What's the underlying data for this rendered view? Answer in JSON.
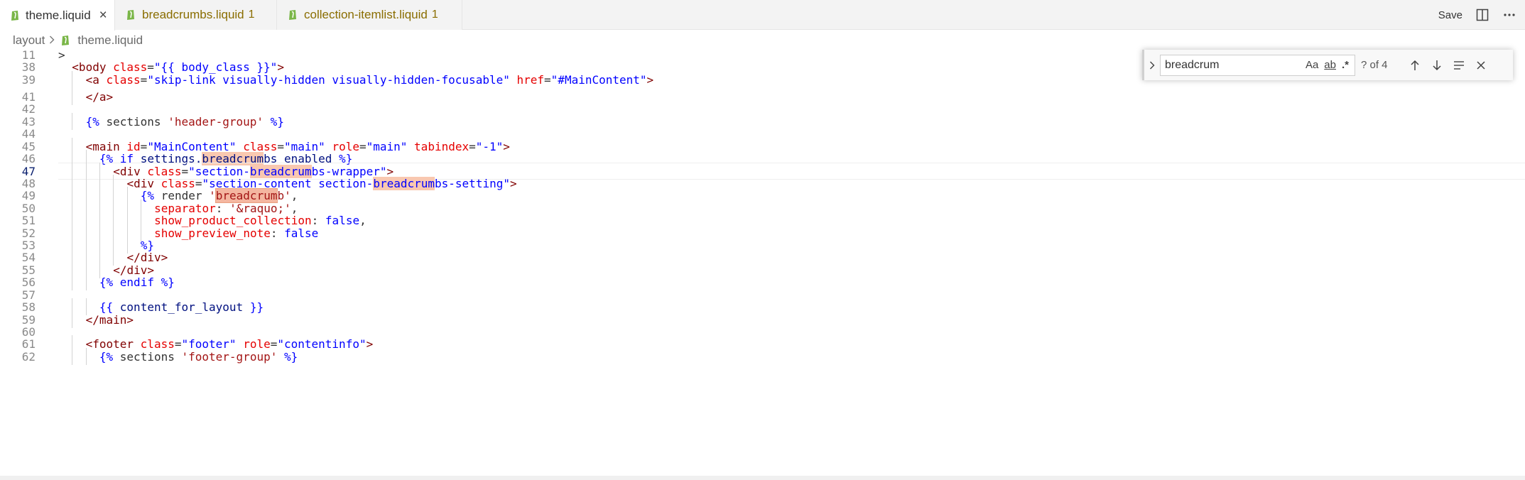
{
  "tabs": [
    {
      "label": "theme.liquid",
      "active": true,
      "badge": "",
      "close": "×"
    },
    {
      "label": "breadcrumbs.liquid",
      "active": false,
      "badge": "1",
      "close": ""
    },
    {
      "label": "collection-itemlist.liquid",
      "active": false,
      "badge": "1",
      "close": ""
    }
  ],
  "actions": {
    "save_label": "Save"
  },
  "breadcrumb": {
    "folder": "layout",
    "file": "theme.liquid"
  },
  "find": {
    "value": "breadcrum",
    "match_case": "Aa",
    "whole_word": "ab",
    "regex": ".*",
    "count": "? of 4"
  },
  "colors": {
    "liquid_icon": "#7ab648",
    "highlight": "#f9c8b0",
    "tag": "#800000",
    "attr": "#e50000",
    "string": "#0000ff"
  },
  "lines": [
    {
      "n": "11",
      "indent": 0,
      "segs": [
        {
          "c": "t-plain",
          "t": ">"
        }
      ]
    },
    {
      "n": "38",
      "indent": 1,
      "segs": [
        {
          "c": "t-tag",
          "t": "<body"
        },
        {
          "c": "t-plain",
          "t": " "
        },
        {
          "c": "t-attr",
          "t": "class"
        },
        {
          "c": "t-plain",
          "t": "="
        },
        {
          "c": "t-str",
          "t": "\"{{ body_class }}\""
        },
        {
          "c": "t-tag",
          "t": ">"
        }
      ]
    },
    {
      "n": "39",
      "indent": 2,
      "segs": [
        {
          "c": "t-tag",
          "t": "<a"
        },
        {
          "c": "t-plain",
          "t": " "
        },
        {
          "c": "t-attr",
          "t": "class"
        },
        {
          "c": "t-plain",
          "t": "="
        },
        {
          "c": "t-str",
          "t": "\"skip-link visually-hidden visually-hidden-focusable\""
        },
        {
          "c": "t-plain",
          "t": " "
        },
        {
          "c": "t-attr",
          "t": "href"
        },
        {
          "c": "t-plain",
          "t": "="
        },
        {
          "c": "t-str",
          "t": "\"#MainContent\""
        },
        {
          "c": "t-tag",
          "t": ">"
        }
      ]
    },
    {
      "n": "41",
      "indent": 2,
      "segs": [
        {
          "c": "t-tag",
          "t": "</a>"
        }
      ]
    },
    {
      "n": "42",
      "indent": 0,
      "segs": []
    },
    {
      "n": "43",
      "indent": 2,
      "segs": [
        {
          "c": "t-liq",
          "t": "{%"
        },
        {
          "c": "t-plain",
          "t": " sections "
        },
        {
          "c": "t-strl",
          "t": "'header-group'"
        },
        {
          "c": "t-liq",
          "t": " %}"
        }
      ]
    },
    {
      "n": "44",
      "indent": 0,
      "segs": []
    },
    {
      "n": "45",
      "indent": 2,
      "segs": [
        {
          "c": "t-tag",
          "t": "<main"
        },
        {
          "c": "t-plain",
          "t": " "
        },
        {
          "c": "t-attr",
          "t": "id"
        },
        {
          "c": "t-plain",
          "t": "="
        },
        {
          "c": "t-str",
          "t": "\"MainContent\""
        },
        {
          "c": "t-plain",
          "t": " "
        },
        {
          "c": "t-attr",
          "t": "class"
        },
        {
          "c": "t-plain",
          "t": "="
        },
        {
          "c": "t-str",
          "t": "\"main\""
        },
        {
          "c": "t-plain",
          "t": " "
        },
        {
          "c": "t-attr",
          "t": "role"
        },
        {
          "c": "t-plain",
          "t": "="
        },
        {
          "c": "t-str",
          "t": "\"main\""
        },
        {
          "c": "t-plain",
          "t": " "
        },
        {
          "c": "t-attr",
          "t": "tabindex"
        },
        {
          "c": "t-plain",
          "t": "="
        },
        {
          "c": "t-str",
          "t": "\"-1\""
        },
        {
          "c": "t-tag",
          "t": ">"
        }
      ]
    },
    {
      "n": "46",
      "indent": 3,
      "segs": [
        {
          "c": "t-liq",
          "t": "{%"
        },
        {
          "c": "t-kw",
          "t": " if "
        },
        {
          "c": "t-var",
          "t": "settings."
        },
        {
          "c": "t-var hl",
          "t": "breadcrum"
        },
        {
          "c": "t-var",
          "t": "bs_enabled"
        },
        {
          "c": "t-liq",
          "t": " %}"
        }
      ]
    },
    {
      "n": "47",
      "indent": 4,
      "cur": true,
      "segs": [
        {
          "c": "t-tag",
          "t": "<div"
        },
        {
          "c": "t-plain",
          "t": " "
        },
        {
          "c": "t-attr",
          "t": "class"
        },
        {
          "c": "t-plain",
          "t": "="
        },
        {
          "c": "t-str",
          "t": "\"section-"
        },
        {
          "c": "t-str hl",
          "t": "breadcrum"
        },
        {
          "c": "t-str",
          "t": "bs-wrapper\""
        },
        {
          "c": "t-tag",
          "t": ">"
        }
      ]
    },
    {
      "n": "48",
      "indent": 5,
      "segs": [
        {
          "c": "t-tag",
          "t": "<div"
        },
        {
          "c": "t-plain",
          "t": " "
        },
        {
          "c": "t-attr",
          "t": "class"
        },
        {
          "c": "t-plain",
          "t": "="
        },
        {
          "c": "t-str",
          "t": "\"section-content section-"
        },
        {
          "c": "t-str hl",
          "t": "breadcrum"
        },
        {
          "c": "t-str",
          "t": "bs-setting\""
        },
        {
          "c": "t-tag",
          "t": ">"
        }
      ]
    },
    {
      "n": "49",
      "indent": 6,
      "segs": [
        {
          "c": "t-liq",
          "t": "{%"
        },
        {
          "c": "t-plain",
          "t": " render "
        },
        {
          "c": "t-strl",
          "t": "'"
        },
        {
          "c": "t-strl hl-cur",
          "t": "breadcrum"
        },
        {
          "c": "t-strl",
          "t": "b'"
        },
        {
          "c": "t-plain",
          "t": ","
        }
      ]
    },
    {
      "n": "50",
      "indent": 7,
      "segs": [
        {
          "c": "t-attr",
          "t": "separator"
        },
        {
          "c": "t-plain",
          "t": ": "
        },
        {
          "c": "t-strl",
          "t": "'&raquo;'"
        },
        {
          "c": "t-plain",
          "t": ","
        }
      ]
    },
    {
      "n": "51",
      "indent": 7,
      "segs": [
        {
          "c": "t-attr",
          "t": "show_product_collection"
        },
        {
          "c": "t-plain",
          "t": ": "
        },
        {
          "c": "t-kw",
          "t": "false"
        },
        {
          "c": "t-plain",
          "t": ","
        }
      ]
    },
    {
      "n": "52",
      "indent": 7,
      "segs": [
        {
          "c": "t-attr",
          "t": "show_preview_note"
        },
        {
          "c": "t-plain",
          "t": ": "
        },
        {
          "c": "t-kw",
          "t": "false"
        }
      ]
    },
    {
      "n": "53",
      "indent": 6,
      "segs": [
        {
          "c": "t-liq",
          "t": "%}"
        }
      ]
    },
    {
      "n": "54",
      "indent": 5,
      "segs": [
        {
          "c": "t-tag",
          "t": "</div>"
        }
      ]
    },
    {
      "n": "55",
      "indent": 4,
      "segs": [
        {
          "c": "t-tag",
          "t": "</div>"
        }
      ]
    },
    {
      "n": "56",
      "indent": 3,
      "segs": [
        {
          "c": "t-liq",
          "t": "{%"
        },
        {
          "c": "t-kw",
          "t": " endif "
        },
        {
          "c": "t-liq",
          "t": "%}"
        }
      ]
    },
    {
      "n": "57",
      "indent": 0,
      "segs": []
    },
    {
      "n": "58",
      "indent": 3,
      "segs": [
        {
          "c": "t-liq",
          "t": "{{"
        },
        {
          "c": "t-var",
          "t": " content_for_layout "
        },
        {
          "c": "t-liq",
          "t": "}}"
        }
      ]
    },
    {
      "n": "59",
      "indent": 2,
      "segs": [
        {
          "c": "t-tag",
          "t": "</main>"
        }
      ]
    },
    {
      "n": "60",
      "indent": 0,
      "segs": []
    },
    {
      "n": "61",
      "indent": 2,
      "segs": [
        {
          "c": "t-tag",
          "t": "<footer"
        },
        {
          "c": "t-plain",
          "t": " "
        },
        {
          "c": "t-attr",
          "t": "class"
        },
        {
          "c": "t-plain",
          "t": "="
        },
        {
          "c": "t-str",
          "t": "\"footer\""
        },
        {
          "c": "t-plain",
          "t": " "
        },
        {
          "c": "t-attr",
          "t": "role"
        },
        {
          "c": "t-plain",
          "t": "="
        },
        {
          "c": "t-str",
          "t": "\"contentinfo\""
        },
        {
          "c": "t-tag",
          "t": ">"
        }
      ]
    },
    {
      "n": "62",
      "indent": 3,
      "segs": [
        {
          "c": "t-liq",
          "t": "{%"
        },
        {
          "c": "t-plain",
          "t": " sections "
        },
        {
          "c": "t-strl",
          "t": "'footer-group'"
        },
        {
          "c": "t-liq",
          "t": " %}"
        }
      ]
    }
  ]
}
